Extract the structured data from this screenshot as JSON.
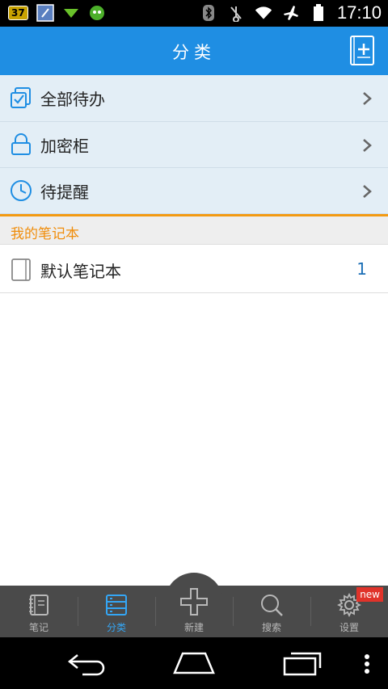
{
  "status_bar": {
    "badge": "37",
    "time": "17:10"
  },
  "header": {
    "title": "分类"
  },
  "categories": [
    {
      "label": "全部待办"
    },
    {
      "label": "加密柜"
    },
    {
      "label": "待提醒"
    }
  ],
  "section": {
    "title": "我的笔记本"
  },
  "notebooks": [
    {
      "label": "默认笔记本",
      "count": "1"
    }
  ],
  "tabs": [
    {
      "label": "笔记"
    },
    {
      "label": "分类"
    },
    {
      "label": "新建"
    },
    {
      "label": "搜索"
    },
    {
      "label": "设置"
    }
  ],
  "settings_badge": "new",
  "colors": {
    "header": "#1f8ee3",
    "accent_orange": "#f08d0b",
    "active_tab": "#34a6f5"
  }
}
